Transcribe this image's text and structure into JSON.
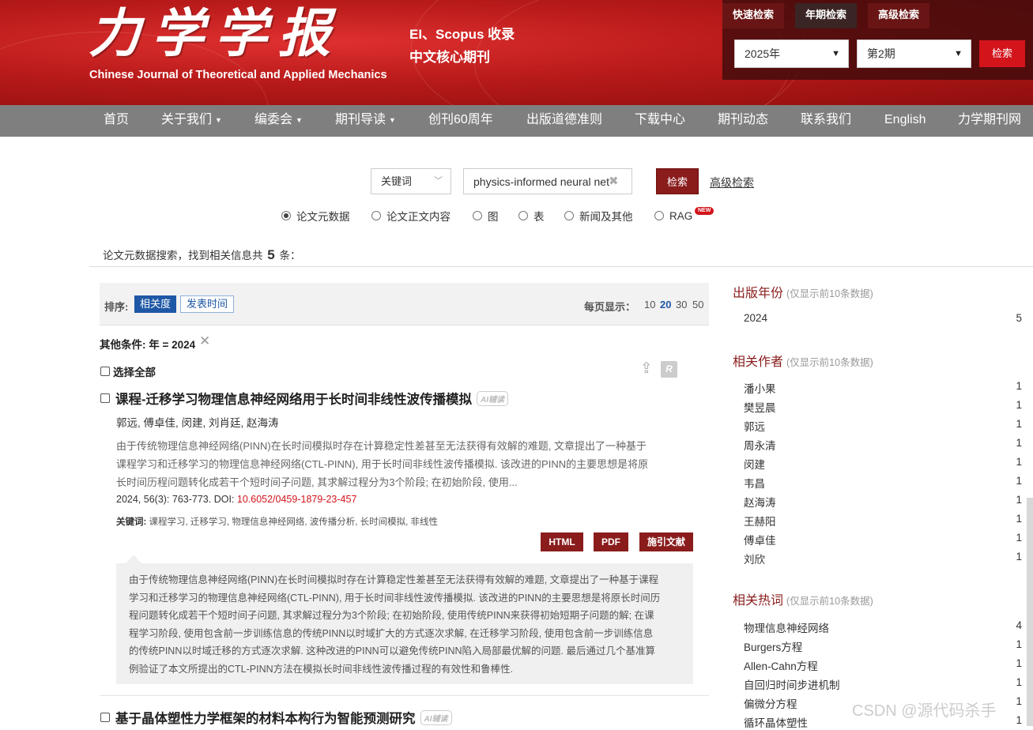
{
  "header": {
    "logo_cn": "力学学报",
    "logo_en": "Chinese Journal of Theoretical and Applied Mechanics",
    "tag_line1": "EI、Scopus 收录",
    "tag_line2": "中文核心期刊"
  },
  "quick_search": {
    "tabs": [
      "快速检索",
      "年期检索",
      "高级检索"
    ],
    "active_tab": "年期检索",
    "year": "2025年",
    "issue": "第2期",
    "button": "检索"
  },
  "nav": [
    {
      "label": "首页",
      "caret": false
    },
    {
      "label": "关于我们",
      "caret": true
    },
    {
      "label": "编委会",
      "caret": true
    },
    {
      "label": "期刊导读",
      "caret": true
    },
    {
      "label": "创刊60周年",
      "caret": false
    },
    {
      "label": "出版道德准则",
      "caret": false
    },
    {
      "label": "下载中心",
      "caret": false
    },
    {
      "label": "期刊动态",
      "caret": false
    },
    {
      "label": "联系我们",
      "caret": false
    },
    {
      "label": "English",
      "caret": false
    },
    {
      "label": "力学期刊网",
      "caret": false
    }
  ],
  "search": {
    "field": "关键词",
    "query": "physics-informed neural network",
    "button": "检索",
    "advanced": "高级检索",
    "scopes": [
      "论文元数据",
      "论文正文内容",
      "图",
      "表",
      "新闻及其他",
      "RAG"
    ],
    "selected_scope": "论文元数据",
    "new_badge": "NEW"
  },
  "results": {
    "summary_prefix": "论文元数据搜索，找到相关信息共",
    "count": "5",
    "summary_suffix": "条：",
    "sort_label": "排序:",
    "sort_options": [
      "相关度",
      "发表时间"
    ],
    "per_page_label": "每页显示：",
    "per_page_options": [
      "10",
      "20",
      "30",
      "50"
    ],
    "per_page_selected": "20",
    "filter": "其他条件: 年 = 2024",
    "select_all": "选择全部",
    "ref_icon": "R"
  },
  "article1": {
    "title": "课程-迁移学习物理信息神经网络用于长时间非线性波传播模拟",
    "ai_badge": "AI辅读",
    "authors": "郭远, 傅卓佳, 闵建, 刘肖廷, 赵海涛",
    "abstract_lines": [
      "由于传统物理信息神经网络(PINN)在长时间模拟时存在计算稳定性差甚至无法获得有效解的难题, 文章提出了一种基于",
      "课程学习和迁移学习的物理信息神经网络(CTL-PINN), 用于长时间非线性波传播模拟. 该改进的PINN的主要思想是将原",
      "长时间历程问题转化成若干个短时间子问题, 其求解过程分为3个阶段; 在初始阶段, 使用..."
    ],
    "citation": "2024, 56(3): 763-773. DOI: ",
    "doi": "10.6052/0459-1879-23-457",
    "keywords_label": "关键词:",
    "keywords": "课程学习, 迁移学习, 物理信息神经网络, 波传播分析, 长时间模拟, 非线性",
    "buttons": [
      "HTML",
      "PDF",
      "施引文献"
    ],
    "full_abstract_lines": [
      "由于传统物理信息神经网络(PINN)在长时间模拟时存在计算稳定性差甚至无法获得有效解的难题, 文章提出了一种基于课程",
      "学习和迁移学习的物理信息神经网络(CTL-PINN), 用于长时间非线性波传播模拟. 该改进的PINN的主要思想是将原长时间历",
      "程问题转化成若干个短时间子问题, 其求解过程分为3个阶段; 在初始阶段, 使用传统PINN来获得初始短期子问题的解; 在课",
      "程学习阶段, 使用包含前一步训练信息的传统PINN以时域扩大的方式逐次求解, 在迁移学习阶段, 使用包含前一步训练信息",
      "的传统PINN以时域迁移的方式逐次求解. 这种改进的PINN可以避免传统PINN陷入局部最优解的问题. 最后通过几个基准算",
      "例验证了本文所提出的CTL-PINN方法在模拟长时间非线性波传播过程的有效性和鲁棒性."
    ]
  },
  "article2": {
    "title": "基于晶体塑性力学框架的材料本构行为智能预测研究",
    "ai_badge": "AI辅读"
  },
  "facets": {
    "note": "(仅显示前10条数据)",
    "year": {
      "title": "出版年份",
      "items": [
        {
          "label": "2024",
          "count": "5"
        }
      ]
    },
    "authors": {
      "title": "相关作者",
      "items": [
        {
          "label": "潘小果",
          "count": "1"
        },
        {
          "label": "樊昱晨",
          "count": "1"
        },
        {
          "label": "郭远",
          "count": "1"
        },
        {
          "label": "周永清",
          "count": "1"
        },
        {
          "label": "闵建",
          "count": "1"
        },
        {
          "label": "韦昌",
          "count": "1"
        },
        {
          "label": "赵海涛",
          "count": "1"
        },
        {
          "label": "王赫阳",
          "count": "1"
        },
        {
          "label": "傅卓佳",
          "count": "1"
        },
        {
          "label": "刘欣",
          "count": "1"
        }
      ]
    },
    "keywords": {
      "title": "相关热词",
      "items": [
        {
          "label": "物理信息神经网络",
          "count": "4"
        },
        {
          "label": "Burgers方程",
          "count": "1"
        },
        {
          "label": "Allen-Cahn方程",
          "count": "1"
        },
        {
          "label": "自回归时间步进机制",
          "count": "1"
        },
        {
          "label": "偏微分方程",
          "count": "1"
        },
        {
          "label": "循环晶体塑性",
          "count": "1"
        }
      ]
    }
  },
  "watermark": "CSDN @源代码杀手"
}
